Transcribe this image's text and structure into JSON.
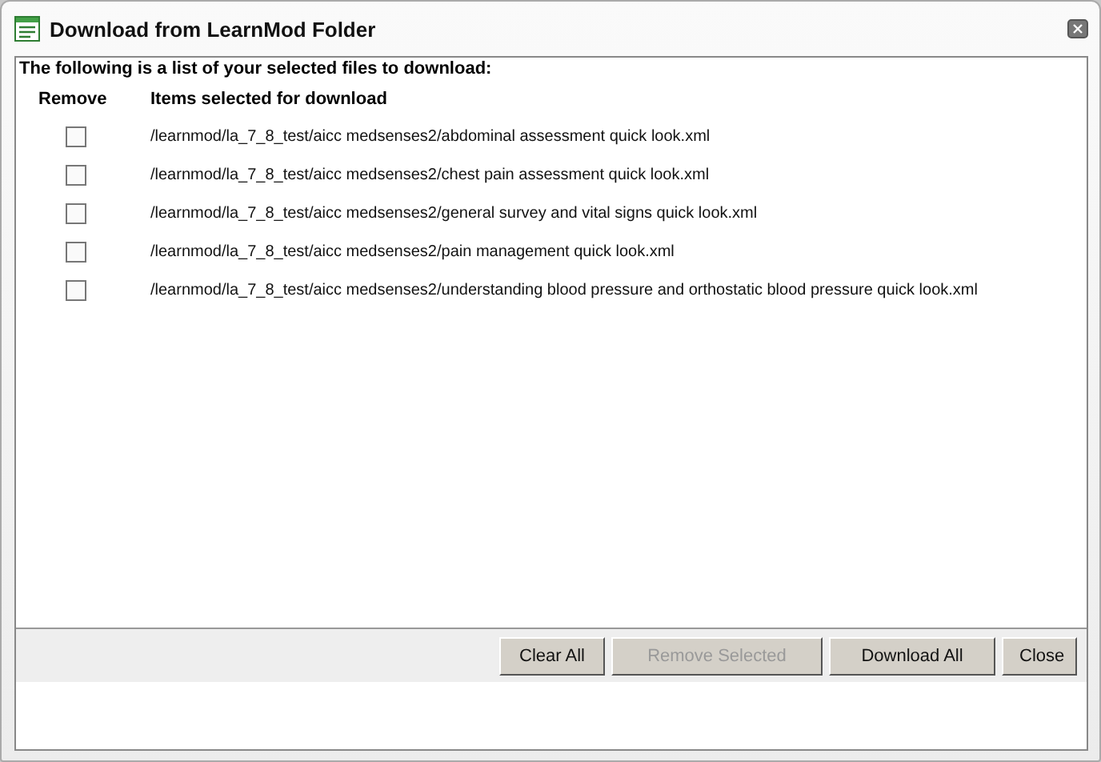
{
  "window": {
    "title": "Download from LearnMod Folder"
  },
  "intro": "The following is a list of your selected files to download:",
  "table": {
    "columns": [
      "Remove",
      "Items selected for download"
    ],
    "rows": [
      {
        "checked": false,
        "path": "/learnmod/la_7_8_test/aicc medsenses2/abdominal assessment quick look.xml"
      },
      {
        "checked": false,
        "path": "/learnmod/la_7_8_test/aicc medsenses2/chest pain assessment quick look.xml"
      },
      {
        "checked": false,
        "path": "/learnmod/la_7_8_test/aicc medsenses2/general survey and vital signs quick look.xml"
      },
      {
        "checked": false,
        "path": "/learnmod/la_7_8_test/aicc medsenses2/pain management quick look.xml"
      },
      {
        "checked": false,
        "path": "/learnmod/la_7_8_test/aicc medsenses2/understanding blood pressure and orthostatic blood pressure quick look.xml"
      }
    ]
  },
  "buttons": [
    {
      "label": "Clear All",
      "disabled": false
    },
    {
      "label": "Remove Selected",
      "disabled": true
    },
    {
      "label": "Download All",
      "disabled": false
    },
    {
      "label": "Close",
      "disabled": false
    }
  ]
}
